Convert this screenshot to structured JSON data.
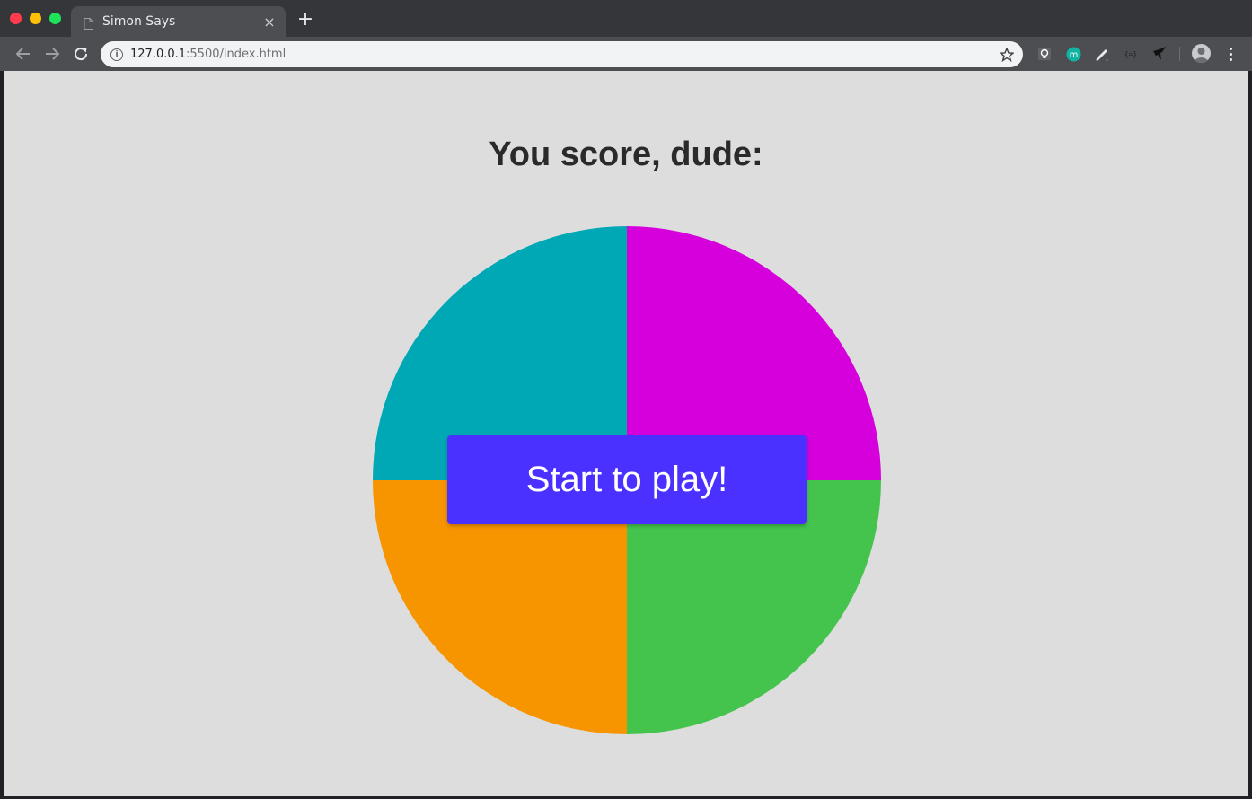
{
  "browser": {
    "tab_title": "Simon Says",
    "tab_close": "×",
    "new_tab": "+",
    "url_host": "127.0.0.1",
    "url_path": ":5500/index.html"
  },
  "page": {
    "score_title": "You score, dude:",
    "start_button": "Start to play!"
  },
  "colors": {
    "top_left": "#00a8b5",
    "top_right": "#d500dc",
    "bottom_left": "#f79500",
    "bottom_right": "#44c44d",
    "start_button_bg": "#4a31ff",
    "page_bg": "#dddddd"
  },
  "icons": {
    "back": "arrow-left-icon",
    "forward": "arrow-right-icon",
    "reload": "reload-icon",
    "site_info": "info-icon",
    "bookmark": "star-icon",
    "extensions": [
      "lightbulb-extension-icon",
      "m-extension-icon",
      "pen-extension-icon",
      "braces-extension-icon",
      "bird-extension-icon"
    ],
    "profile": "avatar-icon",
    "menu": "kebab-menu-icon"
  }
}
